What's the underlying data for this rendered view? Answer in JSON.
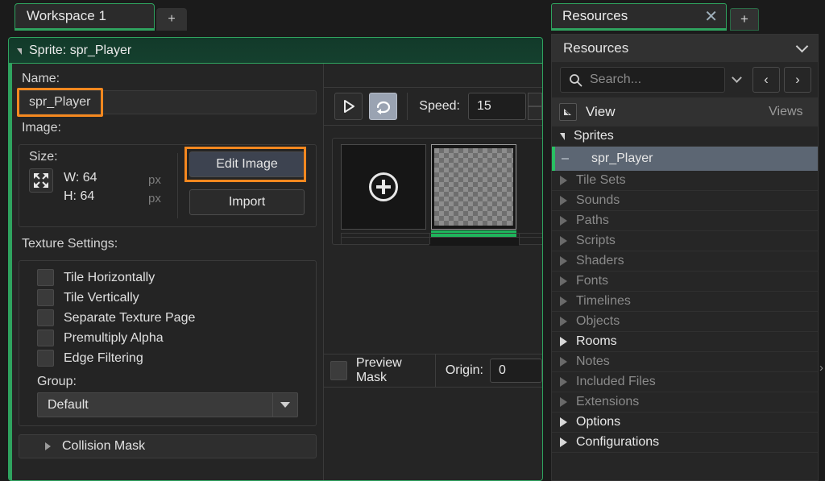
{
  "workspace": {
    "tab_label": "Workspace 1",
    "add_tab_label": "+"
  },
  "sprite_window": {
    "title": "Sprite: spr_Player",
    "name_label": "Name:",
    "name_value": "spr_Player",
    "image_label": "Image:",
    "size_label": "Size:",
    "width_text": "W: 64",
    "height_text": "H: 64",
    "width_unit": "px",
    "height_unit": "px",
    "edit_image_label": "Edit Image",
    "import_label": "Import",
    "texture_settings_label": "Texture Settings:",
    "checkboxes": [
      {
        "label": "Tile Horizontally",
        "checked": false
      },
      {
        "label": "Tile Vertically",
        "checked": false
      },
      {
        "label": "Separate Texture Page",
        "checked": false
      },
      {
        "label": "Premultiply Alpha",
        "checked": false
      },
      {
        "label": "Edge Filtering",
        "checked": false
      }
    ],
    "group_label": "Group:",
    "group_value": "Default",
    "collision_mask_label": "Collision Mask"
  },
  "preview": {
    "play_icon": "play-icon",
    "loop_icon": "loop-icon",
    "loop_active": true,
    "speed_label": "Speed:",
    "speed_value": "15",
    "add_frame_icon": "plus-circle-icon",
    "preview_mask_label": "Preview Mask",
    "preview_mask_checked": false,
    "origin_label": "Origin:",
    "origin_value": "0"
  },
  "resources": {
    "tab_label": "Resources",
    "tab_close_label": "✕",
    "add_tab_label": "+",
    "header_label": "Resources",
    "search_placeholder": "Search...",
    "search_icon": "search-icon",
    "prev_label": "‹",
    "next_label": "›",
    "view_label": "View",
    "views_label": "Views",
    "tree": [
      {
        "label": "Sprites",
        "state": "open",
        "indent": 0
      },
      {
        "label": "spr_Player",
        "state": "selected",
        "indent": 1
      },
      {
        "label": "Tile Sets",
        "state": "dim",
        "indent": 0
      },
      {
        "label": "Sounds",
        "state": "dim",
        "indent": 0
      },
      {
        "label": "Paths",
        "state": "dim",
        "indent": 0
      },
      {
        "label": "Scripts",
        "state": "dim",
        "indent": 0
      },
      {
        "label": "Shaders",
        "state": "dim",
        "indent": 0
      },
      {
        "label": "Fonts",
        "state": "dim",
        "indent": 0
      },
      {
        "label": "Timelines",
        "state": "dim",
        "indent": 0
      },
      {
        "label": "Objects",
        "state": "dim",
        "indent": 0
      },
      {
        "label": "Rooms",
        "state": "bold",
        "indent": 0
      },
      {
        "label": "Notes",
        "state": "dim",
        "indent": 0
      },
      {
        "label": "Included Files",
        "state": "dim",
        "indent": 0
      },
      {
        "label": "Extensions",
        "state": "dim",
        "indent": 0
      },
      {
        "label": "Options",
        "state": "bold",
        "indent": 0
      },
      {
        "label": "Configurations",
        "state": "bold",
        "indent": 0
      }
    ]
  },
  "edge": {
    "chevron_label": "›"
  },
  "colors": {
    "accent_green": "#2fa35f",
    "highlight_orange": "#f5881f",
    "selection_slate": "#5c6673",
    "frame_marker_green": "#1fb55c",
    "window_bg": "#252525",
    "panel_bg": "#262626"
  }
}
